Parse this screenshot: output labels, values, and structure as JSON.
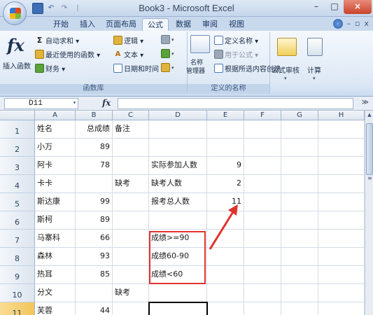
{
  "window": {
    "title": "Book3 - Microsoft Excel",
    "minimize": "–",
    "maximize": "□",
    "close": "×"
  },
  "qat": {
    "separator": "|",
    "undo": "↶",
    "redo": "↷"
  },
  "tabs": [
    {
      "label": "开始",
      "active": false
    },
    {
      "label": "插入",
      "active": false
    },
    {
      "label": "页面布局",
      "active": false
    },
    {
      "label": "公式",
      "active": true
    },
    {
      "label": "数据",
      "active": false
    },
    {
      "label": "审阅",
      "active": false
    },
    {
      "label": "视图",
      "active": false
    }
  ],
  "ribbon_window_controls": {
    "minimize": "–",
    "restore": "▫",
    "close": "x"
  },
  "ribbon": {
    "insert_function": "插入函数",
    "fx": "fx",
    "autosum": "自动求和 ▾",
    "sigma": "Σ",
    "recent": "最近使用的函数 ▾",
    "financial": "财务 ▾",
    "logical": "逻辑 ▾",
    "text": "文本 ▾",
    "text_icon": "A",
    "datetime": "日期和时间 ▾",
    "group_function_library": "函数库",
    "name_manager_line1": "名称",
    "name_manager_line2": "管理器",
    "define_name": "定义名称 ▾",
    "use_in_formula": "用于公式 ▾",
    "create_from_selection": "根据所选内容创建",
    "group_defined_names": "定义的名称",
    "formula_auditing": "公式审核",
    "calculation": "计算",
    "drop": "▾"
  },
  "formula_bar": {
    "cell_ref": "D11",
    "dropdown": "▾",
    "fx": "fx",
    "formula": "",
    "expand": "≫"
  },
  "grid": {
    "columns": [
      "A",
      "B",
      "C",
      "D",
      "E",
      "F",
      "G",
      "H"
    ],
    "row_numbers": [
      "1",
      "2",
      "3",
      "4",
      "5",
      "6",
      "7",
      "8",
      "9",
      "10",
      "11"
    ],
    "active_cell": "D11",
    "rows": [
      [
        "姓名",
        "总成绩",
        "备注",
        "",
        "",
        "",
        "",
        ""
      ],
      [
        "小万",
        "89",
        "",
        "",
        "",
        "",
        "",
        ""
      ],
      [
        "阿卡",
        "78",
        "",
        "实际参加人数",
        "9",
        "",
        "",
        ""
      ],
      [
        "卡卡",
        "",
        "缺考",
        "缺考人数",
        "2",
        "",
        "",
        ""
      ],
      [
        "斯达康",
        "99",
        "",
        "报考总人数",
        "11",
        "",
        "",
        ""
      ],
      [
        "斯柯",
        "89",
        "",
        "",
        "",
        "",
        "",
        ""
      ],
      [
        "马寨科",
        "66",
        "",
        "成绩>=90",
        "",
        "",
        "",
        ""
      ],
      [
        "森林",
        "93",
        "",
        "成绩60-90",
        "",
        "",
        "",
        ""
      ],
      [
        "热耳",
        "85",
        "",
        "成绩<60",
        "",
        "",
        "",
        ""
      ],
      [
        "分文",
        "",
        "缺考",
        "",
        "",
        "",
        "",
        ""
      ],
      [
        "芙蓉",
        "44",
        "",
        "",
        "",
        "",
        "",
        ""
      ]
    ]
  },
  "scrollbar": {
    "up": "▲",
    "grip": "≡"
  },
  "colors": {
    "highlight_box": "#e0322c",
    "arrow": "#e0322c",
    "selected_row_header": "#f3c55a"
  }
}
